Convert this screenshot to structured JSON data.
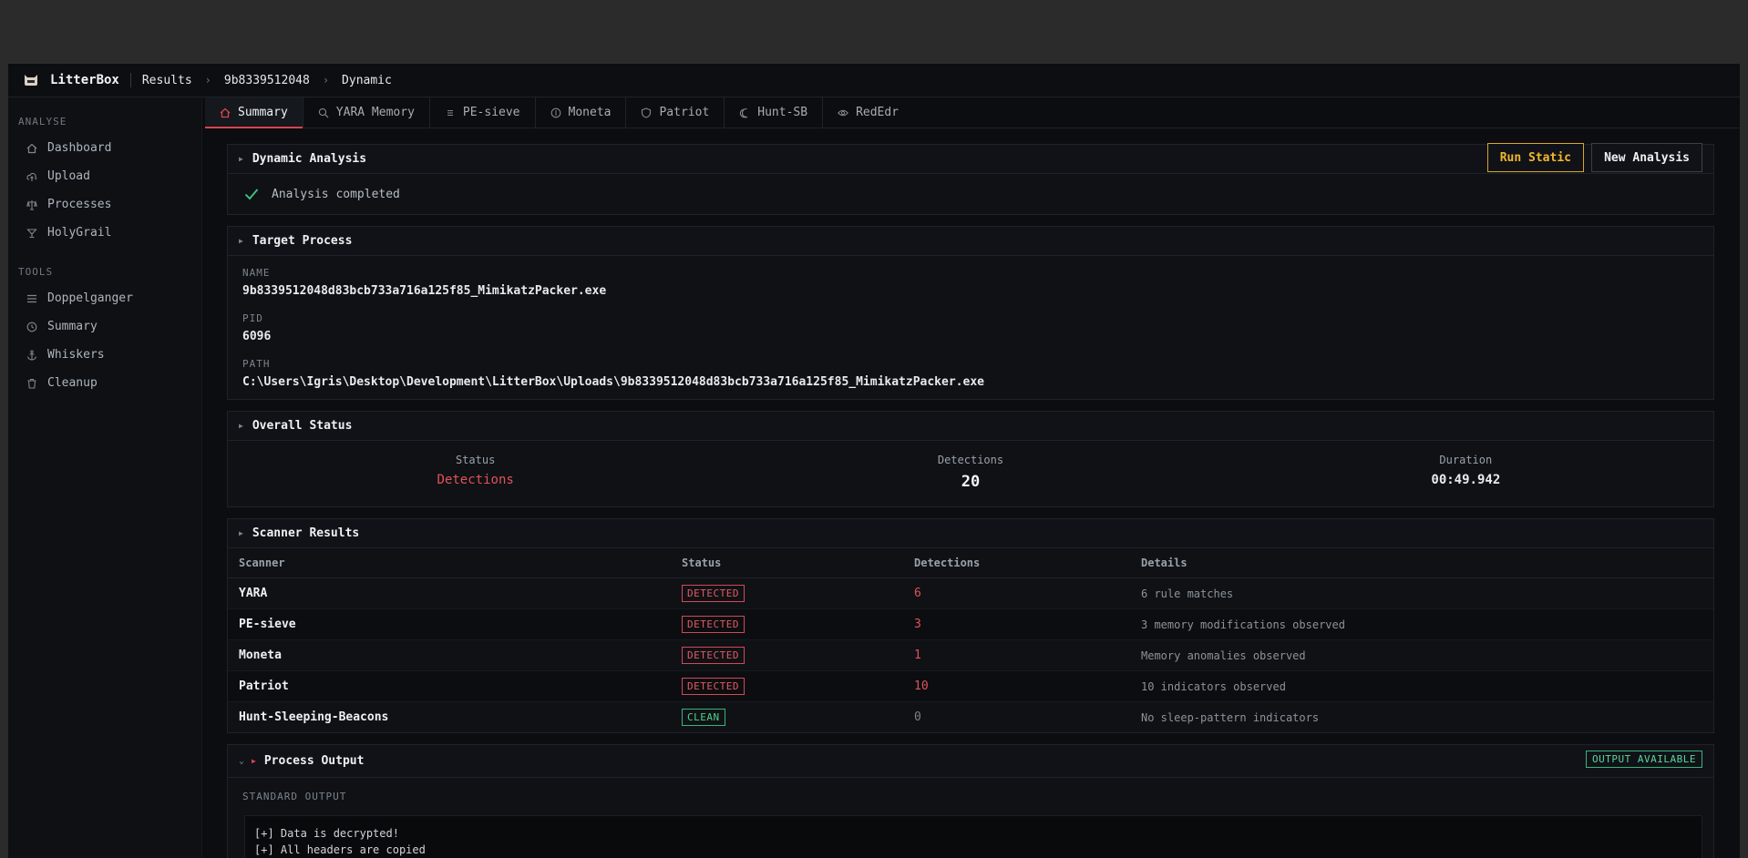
{
  "header": {
    "brand": "LitterBox",
    "breadcrumbs": [
      "Results",
      "9b8339512048",
      "Dynamic"
    ]
  },
  "sidebar": {
    "sections": [
      {
        "title": "ANALYSE",
        "items": [
          {
            "label": "Dashboard",
            "icon": "home-icon"
          },
          {
            "label": "Upload",
            "icon": "upload-icon"
          },
          {
            "label": "Processes",
            "icon": "scale-icon"
          },
          {
            "label": "HolyGrail",
            "icon": "grail-icon"
          }
        ]
      },
      {
        "title": "TOOLS",
        "items": [
          {
            "label": "Doppelganger",
            "icon": "list-icon"
          },
          {
            "label": "Summary",
            "icon": "clock-icon"
          },
          {
            "label": "Whiskers",
            "icon": "anchor-icon"
          },
          {
            "label": "Cleanup",
            "icon": "trash-icon"
          }
        ]
      }
    ]
  },
  "tabs": [
    {
      "label": "Summary",
      "icon": "home-icon",
      "active": true
    },
    {
      "label": "YARA Memory",
      "icon": "search-icon"
    },
    {
      "label": "PE-sieve",
      "icon": "menu-icon"
    },
    {
      "label": "Moneta",
      "icon": "coin-icon"
    },
    {
      "label": "Patriot",
      "icon": "shield-icon"
    },
    {
      "label": "Hunt-SB",
      "icon": "moon-icon"
    },
    {
      "label": "RedEdr",
      "icon": "eye-icon"
    }
  ],
  "dynamic": {
    "title": "Dynamic Analysis",
    "run_static_label": "Run Static",
    "new_analysis_label": "New Analysis",
    "status_text": "Analysis completed"
  },
  "target": {
    "title": "Target Process",
    "name_label": "NAME",
    "name_value": "9b8339512048d83bcb733a716a125f85_MimikatzPacker.exe",
    "pid_label": "PID",
    "pid_value": "6096",
    "path_label": "PATH",
    "path_value": "C:\\Users\\Igris\\Desktop\\Development\\LitterBox\\Uploads\\9b8339512048d83bcb733a716a125f85_MimikatzPacker.exe"
  },
  "overall": {
    "title": "Overall Status",
    "status_label": "Status",
    "status_value": "Detections",
    "detections_label": "Detections",
    "detections_value": "20",
    "duration_label": "Duration",
    "duration_value": "00:49.942"
  },
  "scanner": {
    "title": "Scanner Results",
    "columns": [
      "Scanner",
      "Status",
      "Detections",
      "Details"
    ],
    "rows": [
      {
        "scanner": "YARA",
        "status": "DETECTED",
        "detections": "6",
        "details": "6 rule matches"
      },
      {
        "scanner": "PE-sieve",
        "status": "DETECTED",
        "detections": "3",
        "details": "3 memory modifications observed"
      },
      {
        "scanner": "Moneta",
        "status": "DETECTED",
        "detections": "1",
        "details": "Memory anomalies observed"
      },
      {
        "scanner": "Patriot",
        "status": "DETECTED",
        "detections": "10",
        "details": "10 indicators observed"
      },
      {
        "scanner": "Hunt-Sleeping-Beacons",
        "status": "CLEAN",
        "detections": "0",
        "details": "No sleep-pattern indicators"
      }
    ]
  },
  "output": {
    "title": "Process Output",
    "badge": "OUTPUT AVAILABLE",
    "stdout_label": "STANDARD OUTPUT",
    "lines": [
      "[+] Data is decrypted!",
      "[+] All headers are copied"
    ]
  },
  "colors": {
    "accent_red": "#d9434f",
    "accent_yellow": "#f0b82c",
    "accent_green": "#4fd08c"
  }
}
